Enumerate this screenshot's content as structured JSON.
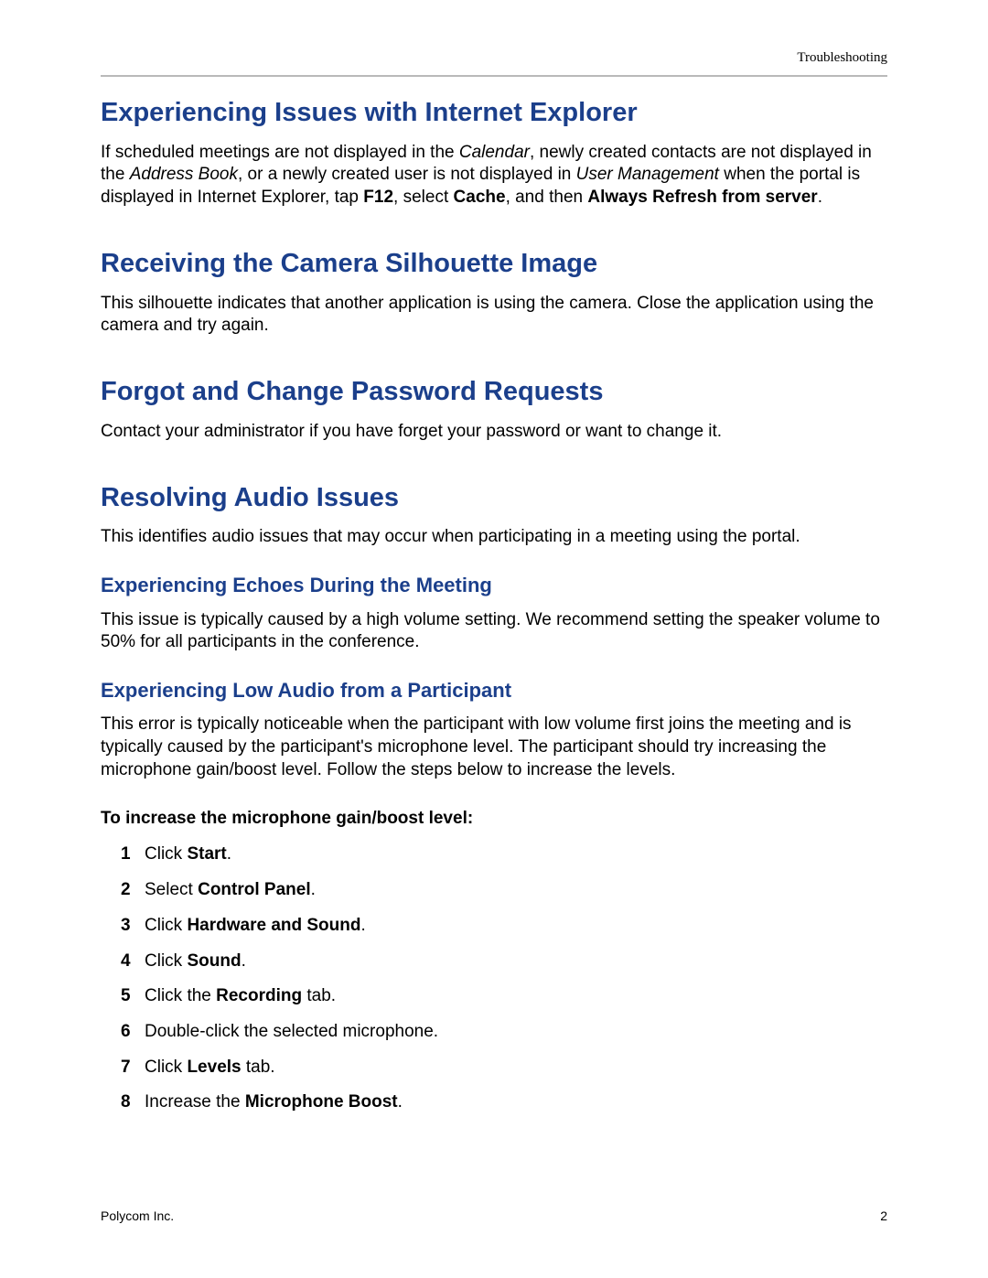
{
  "header": {
    "section_label": "Troubleshooting"
  },
  "s1": {
    "title": "Experiencing Issues with Internet Explorer",
    "p1a": "If scheduled meetings are not displayed in the ",
    "p1b": "Calendar",
    "p1c": ", newly created contacts are not displayed in the ",
    "p1d": "Address Book",
    "p1e": ", or a newly created user is not displayed in ",
    "p1f": "User Management",
    "p1g": " when the portal is displayed in Internet Explorer, tap ",
    "p1h": "F12",
    "p1i": ", select ",
    "p1j": "Cache",
    "p1k": ", and then ",
    "p1l": "Always Refresh from server",
    "p1m": "."
  },
  "s2": {
    "title": "Receiving the Camera Silhouette Image",
    "p1": "This silhouette indicates that another application is using the camera. Close the application using the camera and try again."
  },
  "s3": {
    "title": "Forgot and Change Password Requests",
    "p1": "Contact your administrator if you have forget your password or want to change it."
  },
  "s4": {
    "title": "Resolving Audio Issues",
    "p1": "This identifies audio issues that may occur when participating in a meeting using the portal.",
    "sub1": {
      "title": "Experiencing Echoes During the Meeting",
      "p1": "This issue is typically caused by a high volume setting. We recommend setting the speaker volume to 50% for all participants in the conference."
    },
    "sub2": {
      "title": "Experiencing Low Audio from a Participant",
      "p1": "This error is typically noticeable when the participant with low volume first joins the meeting and is typically caused by the participant's microphone level. The participant should try increasing the microphone gain/boost level. Follow the steps below to increase the levels.",
      "steps_label": "To increase the microphone gain/boost level:",
      "steps": {
        "1a": "Click ",
        "1b": "Start",
        "1c": ".",
        "2a": "Select ",
        "2b": "Control Panel",
        "2c": ".",
        "3a": "Click ",
        "3b": "Hardware and Sound",
        "3c": ".",
        "4a": "Click ",
        "4b": "Sound",
        "4c": ".",
        "5a": "Click the ",
        "5b": "Recording",
        "5c": " tab.",
        "6": "Double-click the selected microphone.",
        "7a": "Click ",
        "7b": "Levels",
        "7c": " tab.",
        "8a": "Increase the ",
        "8b": "Microphone Boost",
        "8c": "."
      }
    }
  },
  "footer": {
    "left": "Polycom Inc.",
    "right": "2"
  }
}
